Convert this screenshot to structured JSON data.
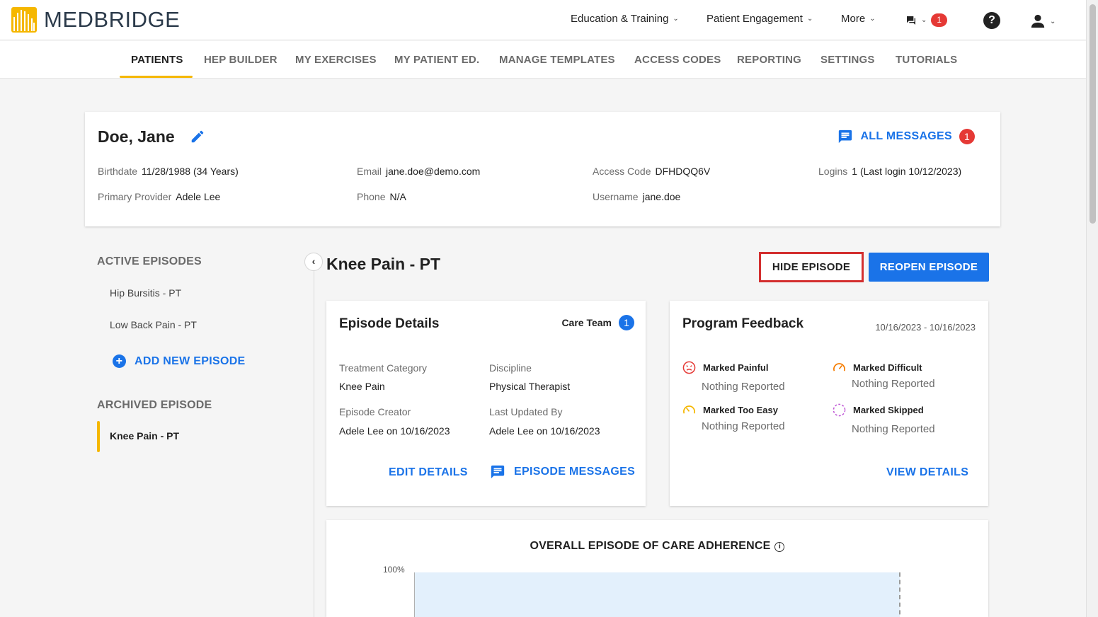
{
  "brand": {
    "name": "MEDBRIDGE"
  },
  "topnav": {
    "education": "Education & Training",
    "engagement": "Patient Engagement",
    "more": "More",
    "message_count": "1",
    "help": "?"
  },
  "subnav": [
    {
      "label": "PATIENTS",
      "active": true
    },
    {
      "label": "HEP BUILDER"
    },
    {
      "label": "MY EXERCISES"
    },
    {
      "label": "MY PATIENT ED."
    },
    {
      "label": "MANAGE TEMPLATES"
    },
    {
      "label": "ACCESS CODES"
    },
    {
      "label": "REPORTING"
    },
    {
      "label": "SETTINGS"
    },
    {
      "label": "TUTORIALS"
    }
  ],
  "patient": {
    "name": "Doe, Jane",
    "all_messages": "ALL MESSAGES",
    "all_messages_count": "1",
    "birthdate_label": "Birthdate",
    "birthdate": "11/28/1988 (34 Years)",
    "email_label": "Email",
    "email": "jane.doe@demo.com",
    "access_label": "Access Code",
    "access": "DFHDQQ6V",
    "logins_label": "Logins",
    "logins": "1 (Last login 10/12/2023)",
    "provider_label": "Primary Provider",
    "provider": "Adele Lee",
    "phone_label": "Phone",
    "phone": "N/A",
    "username_label": "Username",
    "username": "jane.doe"
  },
  "sidebar": {
    "active_heading": "ACTIVE EPISODES",
    "active": [
      "Hip Bursitis - PT",
      "Low Back Pain - PT"
    ],
    "add_episode": "ADD NEW EPISODE",
    "archived_heading": "ARCHIVED EPISODE",
    "archived": [
      "Knee Pain - PT"
    ]
  },
  "episode": {
    "title": "Knee Pain - PT",
    "hide_button": "HIDE EPISODE",
    "reopen_button": "REOPEN EPISODE",
    "details": {
      "title": "Episode Details",
      "care_team": "Care Team",
      "care_team_count": "1",
      "treatment_label": "Treatment Category",
      "treatment": "Knee Pain",
      "discipline_label": "Discipline",
      "discipline": "Physical Therapist",
      "creator_label": "Episode Creator",
      "creator": "Adele Lee on 10/16/2023",
      "updated_label": "Last Updated By",
      "updated": "Adele Lee on 10/16/2023",
      "edit_link": "EDIT DETAILS",
      "messages_link": "EPISODE MESSAGES"
    },
    "feedback": {
      "title": "Program Feedback",
      "range": "10/16/2023 - 10/16/2023",
      "painful": "Marked Painful",
      "painful_value": "Nothing Reported",
      "difficult": "Marked Difficult",
      "difficult_value": "Nothing Reported",
      "easy": "Marked Too Easy",
      "easy_value": "Nothing Reported",
      "skipped": "Marked Skipped",
      "skipped_value": "Nothing Reported",
      "view_link": "VIEW DETAILS"
    },
    "adherence": {
      "title": "OVERALL EPISODE OF CARE ADHERENCE",
      "y_top": "100%"
    }
  },
  "colors": {
    "accent": "#1a73e8",
    "brand_yellow": "#f5b700",
    "alert": "#e53935",
    "highlight_box": "#d32f2f"
  }
}
